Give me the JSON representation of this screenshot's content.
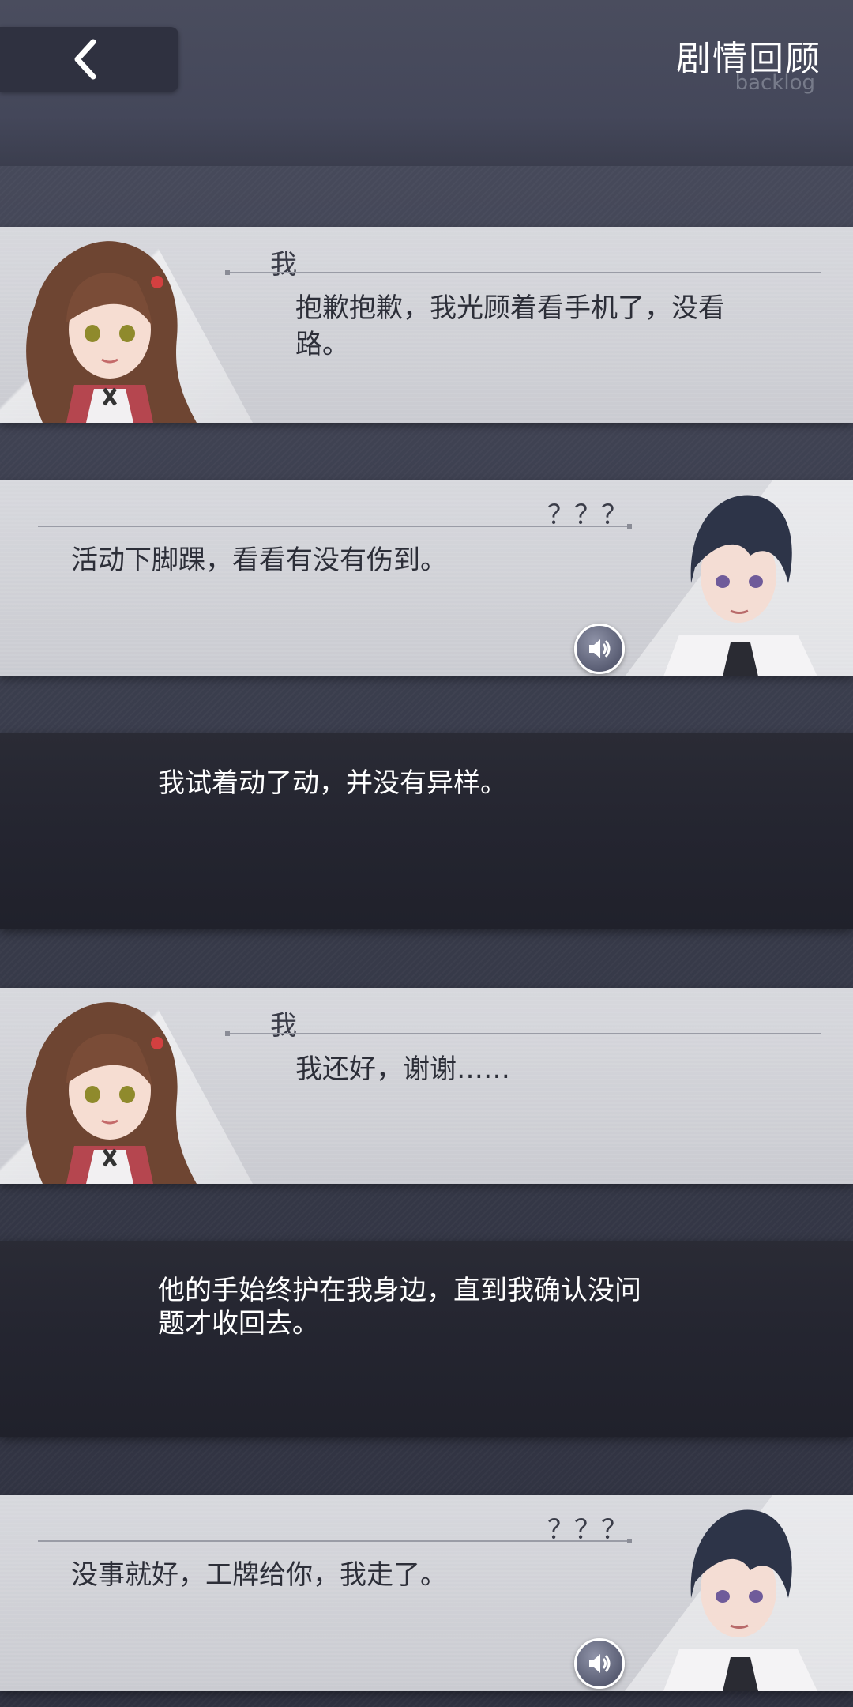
{
  "header": {
    "title": "剧情回顾",
    "subtitle": "backlog",
    "back_icon": "chevron-left-icon"
  },
  "entries": [
    {
      "type": "dialogue",
      "side": "left",
      "speaker": "我",
      "lines": [
        "抱歉抱歉，我光顾着看手机了，没看",
        "路。"
      ],
      "voice": false
    },
    {
      "type": "dialogue",
      "side": "right",
      "speaker": "？？？",
      "lines": [
        "活动下脚踝，看看有没有伤到。"
      ],
      "voice": true
    },
    {
      "type": "narration",
      "lines": [
        "我试着动了动，并没有异样。"
      ]
    },
    {
      "type": "dialogue",
      "side": "left",
      "speaker": "我",
      "lines": [
        "我还好，谢谢……"
      ],
      "voice": false
    },
    {
      "type": "narration",
      "lines": [
        "他的手始终护在我身边，直到我确认没问",
        "题才收回去。"
      ]
    },
    {
      "type": "dialogue",
      "side": "right",
      "speaker": "？？？",
      "lines": [
        "没事就好，工牌给你，我走了。"
      ],
      "voice": true
    }
  ],
  "colors": {
    "background": "#3d4050",
    "card": "#d0d1d6",
    "narration": "#24252f",
    "text_dark": "#2c2e38",
    "text_light": "#ffffff"
  }
}
